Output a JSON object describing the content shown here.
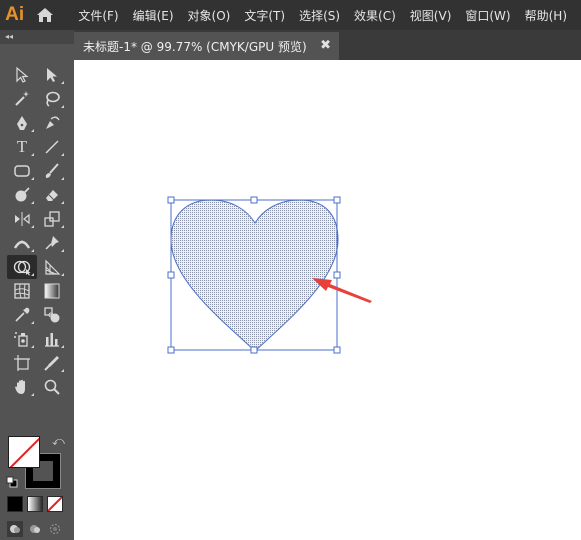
{
  "app": {
    "logo": "Ai",
    "home_icon": "home-icon"
  },
  "menu": [
    {
      "label": "文件(F)"
    },
    {
      "label": "编辑(E)"
    },
    {
      "label": "对象(O)"
    },
    {
      "label": "文字(T)"
    },
    {
      "label": "选择(S)"
    },
    {
      "label": "效果(C)"
    },
    {
      "label": "视图(V)"
    },
    {
      "label": "窗口(W)"
    },
    {
      "label": "帮助(H)"
    }
  ],
  "toolbar": {
    "collapse_glyph": "◂◂",
    "tools": [
      {
        "name": "selection-tool",
        "icon": "arrow-outline-icon"
      },
      {
        "name": "direct-selection-tool",
        "icon": "arrow-solid-icon"
      },
      {
        "name": "magic-wand-tool",
        "icon": "magic-wand-icon"
      },
      {
        "name": "lasso-tool",
        "icon": "lasso-icon"
      },
      {
        "name": "pen-tool",
        "icon": "pen-icon"
      },
      {
        "name": "curvature-tool",
        "icon": "curvature-pen-icon"
      },
      {
        "name": "type-tool",
        "icon": "type-icon",
        "glyph": "T"
      },
      {
        "name": "line-tool",
        "icon": "line-segment-icon"
      },
      {
        "name": "rectangle-tool",
        "icon": "rounded-rectangle-icon"
      },
      {
        "name": "paintbrush-tool",
        "icon": "paintbrush-icon"
      },
      {
        "name": "shaper-tool",
        "icon": "shaper-icon"
      },
      {
        "name": "eraser-tool",
        "icon": "eraser-icon"
      },
      {
        "name": "reflect-tool",
        "icon": "reflect-icon"
      },
      {
        "name": "scale-tool",
        "icon": "scale-icon"
      },
      {
        "name": "width-tool",
        "icon": "width-icon"
      },
      {
        "name": "puppet-warp-tool",
        "icon": "pin-icon"
      },
      {
        "name": "shape-builder-tool",
        "icon": "shape-builder-icon",
        "active": true
      },
      {
        "name": "perspective-grid-tool",
        "icon": "perspective-grid-icon"
      },
      {
        "name": "mesh-tool",
        "icon": "mesh-icon"
      },
      {
        "name": "gradient-tool",
        "icon": "gradient-icon"
      },
      {
        "name": "eyedropper-tool",
        "icon": "eyedropper-icon"
      },
      {
        "name": "blend-tool",
        "icon": "blend-icon"
      },
      {
        "name": "symbol-sprayer-tool",
        "icon": "symbol-sprayer-icon"
      },
      {
        "name": "column-graph-tool",
        "icon": "column-graph-icon"
      },
      {
        "name": "artboard-tool",
        "icon": "artboard-icon"
      },
      {
        "name": "slice-tool",
        "icon": "slice-knife-icon"
      },
      {
        "name": "hand-tool",
        "icon": "hand-icon"
      },
      {
        "name": "zoom-tool",
        "icon": "magnifier-icon"
      }
    ],
    "fill_color": "#ffffff",
    "stroke_color": "#000000",
    "none_slash_color": "#e02020",
    "swap_icon": "swap-arrow-icon",
    "default_colors_icon": "default-colors-icon",
    "color_modes": [
      "color-mode-icon",
      "gradient-mode-icon",
      "none-mode-icon"
    ],
    "draw_modes": [
      "draw-normal-icon",
      "draw-behind-icon",
      "draw-inside-icon"
    ],
    "screen_mode_icon": "screen-mode-icon"
  },
  "document": {
    "tab_title": "未标题-1* @ 99.77% (CMYK/GPU 预览)",
    "close_glyph": "✖"
  },
  "canvas": {
    "heart_fill": "#c7ccd6",
    "selection_color": "#4a6fcc",
    "arrow_color": "#e8403a"
  }
}
